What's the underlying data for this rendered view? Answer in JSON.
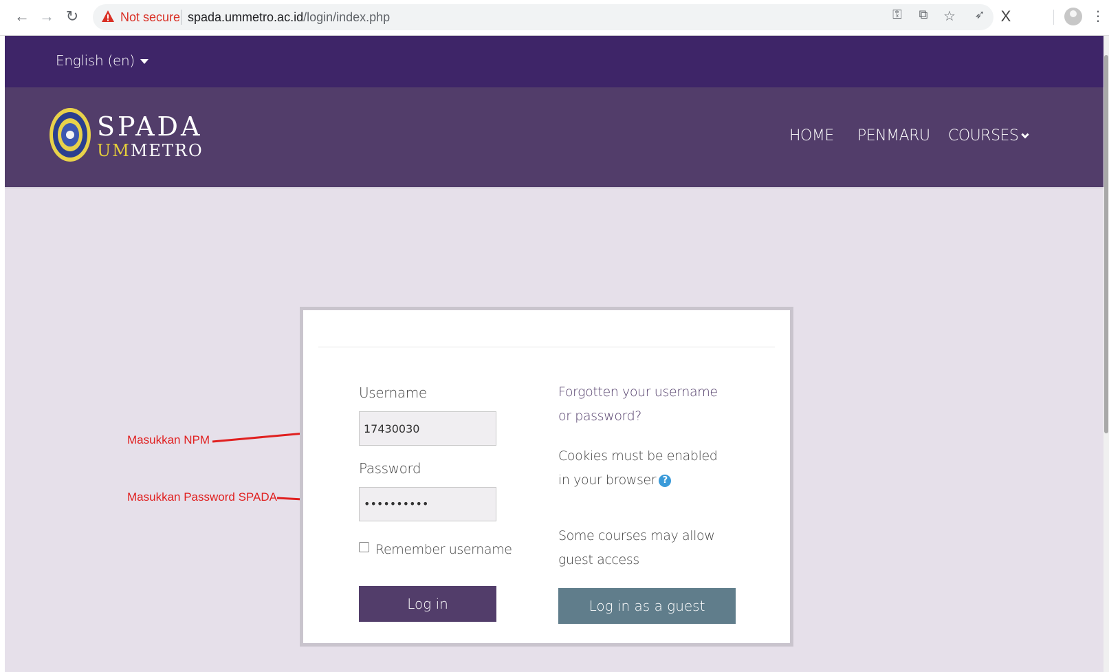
{
  "browser": {
    "security_label": "Not secure",
    "url_host": "spada.ummetro.ac.id",
    "url_path": "/login/index.php",
    "icons": [
      "back-icon",
      "forward-icon",
      "reload-icon",
      "key-icon",
      "translate-icon",
      "star-icon",
      "extension-icon",
      "x-extension-icon",
      "profile-icon",
      "menu-icon"
    ]
  },
  "topbar": {
    "language": "English (en)"
  },
  "header": {
    "logo_title": "SPADA",
    "logo_sub_prefix": "UM",
    "logo_sub_suffix": "METRO",
    "nav": [
      "HOME",
      "PENMARU",
      "COURSES"
    ]
  },
  "login": {
    "username_label": "Username",
    "username_value": "17430030",
    "password_label": "Password",
    "password_value": "••••••••••",
    "remember_label": "Remember username",
    "login_button": "Log in",
    "forgot_link": "Forgotten your username or password?",
    "cookies_text": "Cookies must be enabled in your browser",
    "guest_text": "Some courses may allow guest access",
    "guest_button": "Log in as a guest"
  },
  "annotations": {
    "npm": "Masukkan NPM",
    "password": "Masukkan Password SPADA"
  },
  "colors": {
    "topbar": "#3e2568",
    "header": "#523d6a",
    "page_bg": "#e6e0ea",
    "guest_button": "#607d8b",
    "annotation": "#e02020"
  }
}
